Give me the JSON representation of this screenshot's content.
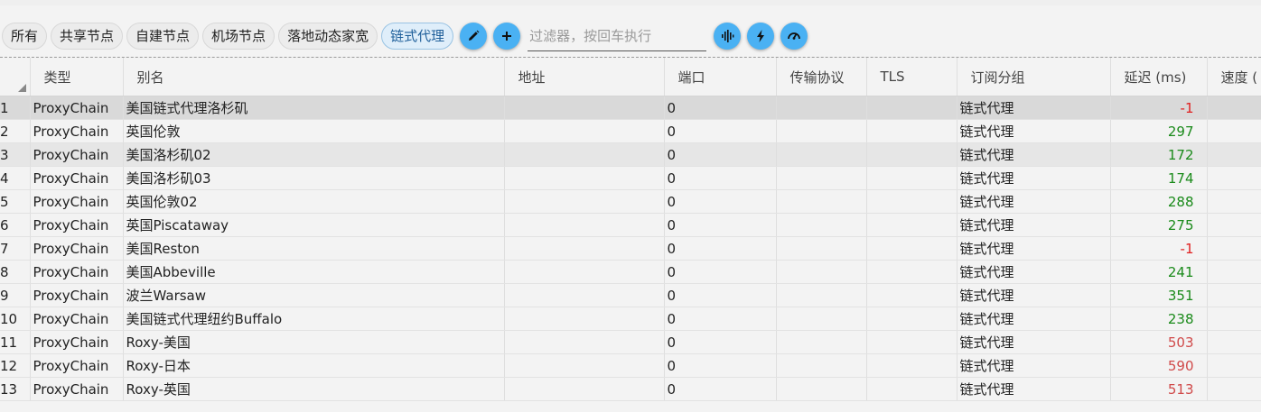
{
  "filters": {
    "chips": [
      {
        "label": "所有",
        "active": false
      },
      {
        "label": "共享节点",
        "active": false
      },
      {
        "label": "自建节点",
        "active": false
      },
      {
        "label": "机场节点",
        "active": false
      },
      {
        "label": "落地动态家宽",
        "active": false
      },
      {
        "label": "链式代理",
        "active": true
      }
    ],
    "search_placeholder": "过滤器，按回车执行"
  },
  "table": {
    "columns": [
      "",
      "类型",
      "别名",
      "地址",
      "端口",
      "传输协议",
      "TLS",
      "订阅分组",
      "延迟 (ms)",
      "速度 ("
    ],
    "rows": [
      {
        "index": "1",
        "type": "ProxyChain",
        "alias": "美国链式代理洛杉矶",
        "address": "",
        "port": "0",
        "transport": "",
        "tls": "",
        "group": "链式代理",
        "delay": "-1",
        "delay_color": "#e02020",
        "speed": ""
      },
      {
        "index": "2",
        "type": "ProxyChain",
        "alias": "英国伦敦",
        "address": "",
        "port": "0",
        "transport": "",
        "tls": "",
        "group": "链式代理",
        "delay": "297",
        "delay_color": "#1a8a1a",
        "speed": ""
      },
      {
        "index": "3",
        "type": "ProxyChain",
        "alias": "美国洛杉矶02",
        "address": "",
        "port": "0",
        "transport": "",
        "tls": "",
        "group": "链式代理",
        "delay": "172",
        "delay_color": "#1a8a1a",
        "speed": ""
      },
      {
        "index": "4",
        "type": "ProxyChain",
        "alias": "美国洛杉矶03",
        "address": "",
        "port": "0",
        "transport": "",
        "tls": "",
        "group": "链式代理",
        "delay": "174",
        "delay_color": "#1a8a1a",
        "speed": ""
      },
      {
        "index": "5",
        "type": "ProxyChain",
        "alias": "英国伦敦02",
        "address": "",
        "port": "0",
        "transport": "",
        "tls": "",
        "group": "链式代理",
        "delay": "288",
        "delay_color": "#1a8a1a",
        "speed": ""
      },
      {
        "index": "6",
        "type": "ProxyChain",
        "alias": "英国Piscataway",
        "address": "",
        "port": "0",
        "transport": "",
        "tls": "",
        "group": "链式代理",
        "delay": "275",
        "delay_color": "#1a8a1a",
        "speed": ""
      },
      {
        "index": "7",
        "type": "ProxyChain",
        "alias": "美国Reston",
        "address": "",
        "port": "0",
        "transport": "",
        "tls": "",
        "group": "链式代理",
        "delay": "-1",
        "delay_color": "#e02020",
        "speed": ""
      },
      {
        "index": "8",
        "type": "ProxyChain",
        "alias": "美国Abbeville",
        "address": "",
        "port": "0",
        "transport": "",
        "tls": "",
        "group": "链式代理",
        "delay": "241",
        "delay_color": "#1a8a1a",
        "speed": ""
      },
      {
        "index": "9",
        "type": "ProxyChain",
        "alias": "波兰Warsaw",
        "address": "",
        "port": "0",
        "transport": "",
        "tls": "",
        "group": "链式代理",
        "delay": "351",
        "delay_color": "#1a8a1a",
        "speed": ""
      },
      {
        "index": "10",
        "type": "ProxyChain",
        "alias": "美国链式代理纽约Buffalo",
        "address": "",
        "port": "0",
        "transport": "",
        "tls": "",
        "group": "链式代理",
        "delay": "238",
        "delay_color": "#1a8a1a",
        "speed": ""
      },
      {
        "index": "11",
        "type": "ProxyChain",
        "alias": "Roxy-美国",
        "address": "",
        "port": "0",
        "transport": "",
        "tls": "",
        "group": "链式代理",
        "delay": "503",
        "delay_color": "#d04a4a",
        "speed": ""
      },
      {
        "index": "12",
        "type": "ProxyChain",
        "alias": "Roxy-日本",
        "address": "",
        "port": "0",
        "transport": "",
        "tls": "",
        "group": "链式代理",
        "delay": "590",
        "delay_color": "#d04a4a",
        "speed": ""
      },
      {
        "index": "13",
        "type": "ProxyChain",
        "alias": "Roxy-英国",
        "address": "",
        "port": "0",
        "transport": "",
        "tls": "",
        "group": "链式代理",
        "delay": "513",
        "delay_color": "#d04a4a",
        "speed": ""
      }
    ]
  },
  "icons": {
    "edit": "pencil-icon",
    "add": "plus-icon",
    "test_ping": "waveform-icon",
    "test_realping": "lightning-icon",
    "test_speed": "speedometer-icon"
  }
}
